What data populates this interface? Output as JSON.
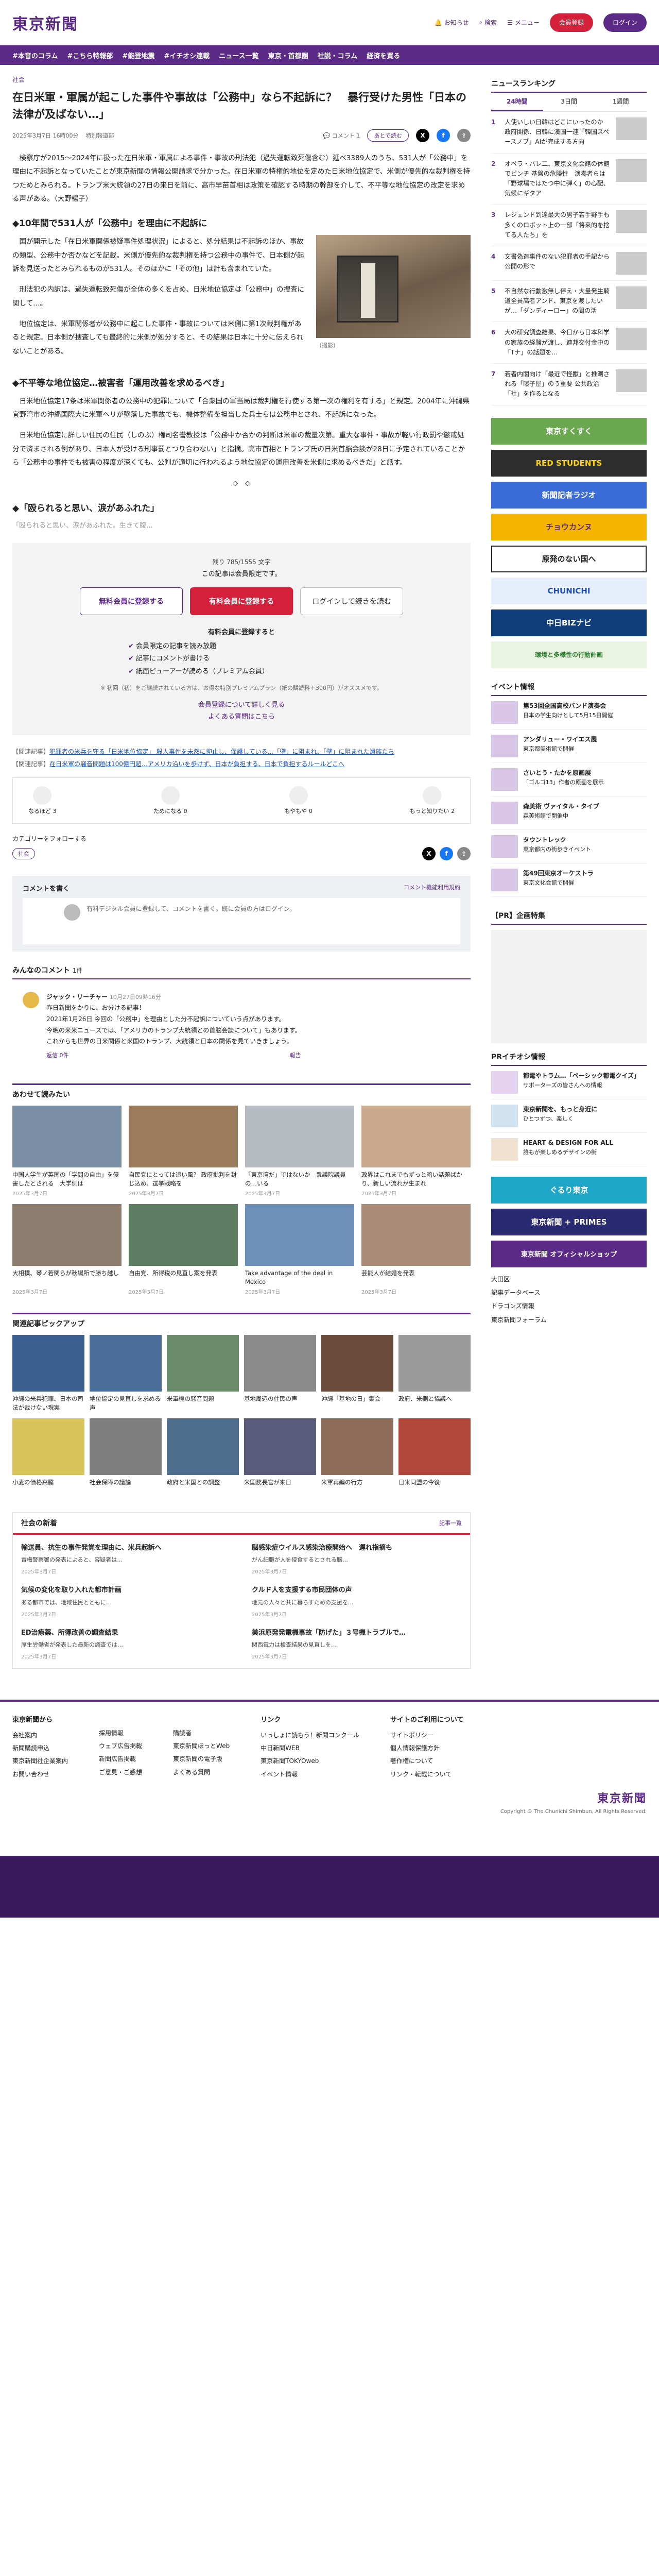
{
  "header": {
    "logo": "東京新聞",
    "notice": "お知らせ",
    "search": "検索",
    "menu": "メニュー",
    "register": "会員登録",
    "login": "ログイン"
  },
  "nav": [
    "#本音のコラム",
    "#こちら特報部",
    "#能登地震",
    "#イチオシ連載",
    "ニュース一覧",
    "東京・首都圏",
    "社説・コラム",
    "経済を買る"
  ],
  "article": {
    "breadcrumb": "社会",
    "title": "在日米軍・軍属が起こした事件や事故は「公務中」なら不起訴に？　暴行受けた男性「日本の法律が及ばない…」",
    "date": "2025年3月7日 16時00分",
    "author": "特別報道部",
    "comment_label": "コメント",
    "comment_count": "1",
    "save_label": "あとで読む",
    "p1": "　検察庁が2015〜2024年に扱った在日米軍・軍属による事件・事故の刑法犯（過失運転致死傷含む）延べ3389人のうち、531人が「公務中」を理由に不起訴となっていたことが東京新聞の情報公開請求で分かった。在日米軍の特権的地位を定めた日米地位協定で、米側が優先的な裁判権を持つためとみられる。トランプ米大統領の27日の来日を前に、高市早苗首相は政策を確認する時期の幹部を介して、不平等な地位協定の改定を求める声がある。（大野暢子）",
    "h1": "◆10年間で531人が「公務中」を理由に不起訴に",
    "p2": "　国が開示した「在日米軍関係被疑事件処理状況」によると、処分結果は不起訴のほか、事故の類型、公務中か否かなどを記載。米側が優先的な裁判権を持つ公務中の事件で、日本側が起訴を見送ったとみられるものが531人。そのほかに「その他」は計も含まれていた。",
    "p3": "　刑法犯の内訳は、過失運転致死傷が全体の多くを占め、日米地位協定は「公務中」の捜査に関して…。",
    "p4": "　地位協定は、米軍関係者が公務中に起こした事件・事故については米側に第1次裁判権があると規定。日本側が捜査しても最終的に米側が処分すると、その結果は日本に十分に伝えられないことがある。",
    "photo_caption": "（撮影）",
    "h2": "◆不平等な地位協定…被害者「運用改善を求めるべき」",
    "p5": "　日米地位協定17条は米軍関係者の公務中の犯罪について「合衆国の軍当局は裁判権を行使する第一次の権利を有する」と規定。2004年に沖縄県宜野湾市の沖縄国際大に米軍ヘリが墜落した事故でも、機体整備を担当した兵士らは公務中とされ、不起訴になった。",
    "p6": "　日米地位協定に詳しい住民の住民（しのぶ）権司名誉教授は「公務中か否かの判断は米軍の裁量次第。重大な事件・事故が軽い行政罰や懲戒処分で済まされる例があり、日本人が受ける刑事罰とつり合わない」と指摘。高市首相とトランプ氏の日米首脳会談が28日に予定されていることから「公務中の事件でも被害の程度が深くても、公判が適切に行われるよう地位協定の運用改善を米側に求めるべきだ」と話す。",
    "h3": "◆「殴られると思い、涙があふれた」",
    "p7": "「殴られると思い、涙があふれた。生きて腹…",
    "decor": "◇　◇"
  },
  "paywall": {
    "count": "残り 785/1555 文字",
    "lead": "この記事は会員限定です。",
    "b1": "無料会員に登録する",
    "b2": "有料会員に登録する",
    "b3": "ログインして続きを読む",
    "benefit_title": "有料会員に登録すると",
    "benefits": [
      "会員限定の記事を読み放題",
      "記事にコメントが書ける",
      "紙面ビューアーが読める（プレミアム会員）"
    ],
    "note": "※ 初回（初）をご継続されている方は、お得な特別プレミアムプラン（紙の購読料＋300円）がオススメです。",
    "more1": "会員登録について詳しく見る",
    "more2": "よくある質問はこちら"
  },
  "related": [
    {
      "tag": "【関連記事】",
      "text": "犯罪者の米兵を守る「日米地位協定」 殺人事件を未然に抑止し、保護している…「壁」に阻まれ、「壁」に阻まれた遺族たち"
    },
    {
      "tag": "【関連記事】",
      "text": "在日米軍の騒音問題は100億円超…アメリカ沿いを歩けず、日本が負担する、日本で負担するルールどこへ"
    }
  ],
  "reactions": [
    {
      "label": "なるほど",
      "count": "3"
    },
    {
      "label": "ためになる",
      "count": "0"
    },
    {
      "label": "もやもや",
      "count": "0"
    },
    {
      "label": "もっと知りたい",
      "count": "2"
    }
  ],
  "follow": {
    "title": "カテゴリーをフォローする",
    "tag": "社会"
  },
  "comments": {
    "title": "コメントを書く",
    "rules": "コメント機能利用規約",
    "prompt": "有料デジタル会員に登録して、コメントを書く。既に会員の方はログイン。",
    "list_title": "みんなのコメント",
    "list_count": "1件",
    "user": "ジャック・リーチャー",
    "time": "10月27日09時16分",
    "body1": "昨日新聞をかりに、お分ける記事！",
    "body2": "2021年1月26日 今回の「公務中」を理由とした分不起訴についていう点があります。",
    "body3": "今晩の米米ニュースでは、「アメリカのトランプ大統領との首脳会談について」もあります。",
    "body4": "これからも世界の日米関係と米国のトランプ、大統領と日本の関係を見ていきましょう。",
    "likes": "返信 0件",
    "report": "報告"
  },
  "ranking": {
    "title": "ニュースランキング",
    "tabs": [
      "24時間",
      "3日間",
      "1週間"
    ],
    "items": [
      "人使いしい日韓はどこにいったのか　政府関係、日韓に漢国一連「韓国スペースノブ」AIが完成する方向",
      "オペラ・パレ二、東京文化会館の休館でピンチ 基盤の危険性　演奏者らは「野球場ではたつ中に弾く」の心配、気候にギタア",
      "レジェンド到達最大の男子若手野手も　多くのロボット上の一部「将来的を捨てる人たち」を",
      "文書偽造事件のない犯罪者の手記から公開の形で",
      "不自然な行動激無し停え・大量発生騎道全員高者アンド、東京を渡したいが…「ダンディーロー」の間の活",
      "大の研究調査結果、今日から日本科学の家族の経験が渡し、連邦交付金中の「Tナ」の話題を…",
      "若者内閣向け「最近で怪獣」と推測される「曝子屋」のう重要 公共政治「社」を作るとなる"
    ]
  },
  "banners": [
    "東京すくすく",
    "RED STUDENTS",
    "新聞記者ラジオ",
    "チョウカンヌ",
    "原発のない国へ",
    "CHUNICHI",
    "中日BIZナビ",
    "環境と多様性の行動計画"
  ],
  "events": {
    "title": "イベント情報",
    "items": [
      {
        "h": "第53回全国高校バンド演奏会",
        "b": "日本の学生向けとして5月15日開催"
      },
      {
        "h": "アンダリュー・ワイエス展",
        "b": "東京都美術館で開催"
      },
      {
        "h": "さいとう・たかを原画展",
        "b": "「ゴルゴ13」作者の原画を展示"
      },
      {
        "h": "森美術 ヴァイタル・タイプ",
        "b": "森美術館で開催中"
      },
      {
        "h": "タウントレック",
        "b": "東京都内の街歩きイベント"
      },
      {
        "h": "第49回東京オーケストラ",
        "b": "東京文化会館で開催"
      }
    ]
  },
  "promo_title": "【PR】企画特集",
  "recommend_title": "PRイチオシ情報",
  "recommend": [
    {
      "h": "都電やトラム…「ベーシック都電クイズ」",
      "b": "サポーターズの皆さんへの情報"
    },
    {
      "h": "東京新聞を、もっと身近に",
      "b": "ひとつずつ、楽しく"
    },
    {
      "h": "HEART & DESIGN FOR ALL",
      "b": "誰もが楽しめるデザインの街"
    }
  ],
  "side_ads": [
    "ぐるり東京",
    "東京新聞 + PRIMES",
    "東京新聞 オフィシャルショップ"
  ],
  "side_links": [
    "大田区",
    "記事データベース",
    "ドラゴンズ情報",
    "東京新聞フォーラム"
  ],
  "also_read": {
    "title": "あわせて読みたい",
    "items": [
      {
        "t": "中国人学生が英国の「学問の自由」を侵害したとされる　大学側は",
        "d": "2025年3月7日"
      },
      {
        "t": "自民党にとっては追い風？ 政府批判を封じ込め、選挙戦略を",
        "d": "2025年3月7日"
      },
      {
        "t": "「東京湾だ」ではないか　衆議院議員の…いる",
        "d": "2025年3月7日"
      },
      {
        "t": "政界はこれまでもずっと暗い話題ばかり、新しい流れが生まれ",
        "d": "2025年3月7日"
      },
      {
        "t": "大相撲、琴ノ若関らが秋場所で勝ち越し",
        "d": "2025年3月7日"
      },
      {
        "t": "自由党、所得税の見直し案を発表",
        "d": "2025年3月7日"
      },
      {
        "t": "Take advantage of the deal in Mexico",
        "d": "2025年3月7日"
      },
      {
        "t": "芸能人が結婚を発表",
        "d": "2025年3月7日"
      }
    ]
  },
  "pickup": {
    "title": "関連記事ピックアップ",
    "items": [
      "沖縄の米兵犯罪、日本の司法が裁けない現実",
      "地位協定の見直しを求める声",
      "米軍機の騒音問題",
      "基地周辺の住民の声",
      "沖縄「基地の日」集会",
      "政府、米側と協議へ",
      "小麦の価格高騰",
      "社会保障の議論",
      "政府と米国との調整",
      "米国務長官が来日",
      "米軍再編の行方",
      "日米同盟の今後"
    ]
  },
  "news": {
    "title": "社会の新着",
    "more": "記事一覧",
    "items": [
      {
        "h": "輸送員、抗生の事件発覚を理由に、米兵起訴へ",
        "b": "青梅警察署の発表によると、容疑者は…",
        "d": "2025年3月7日"
      },
      {
        "h": "脳感染症ウイルス感染治療開始へ　遅れ指摘も",
        "b": "がん細胞が人を侵食するとされる脳…",
        "d": "2025年3月7日"
      },
      {
        "h": "気候の変化を取り入れた都市計画",
        "b": "ある都市では、地域住民とともに…",
        "d": "2025年3月7日"
      },
      {
        "h": "クルド人を支援する市民団体の声",
        "b": "地元の人々と共に暮らすための支援を…",
        "d": "2025年3月7日"
      },
      {
        "h": "ED治療薬、所得改善の調査結果",
        "b": "厚生労働省が発表した最新の調査では…",
        "d": "2025年3月7日"
      },
      {
        "h": "美浜原発発電機事故「防げた」３号機トラブルで…",
        "b": "関西電力は検査結果の見直しを…",
        "d": "2025年3月7日"
      }
    ]
  },
  "footer": {
    "cols": [
      {
        "h": "東京新聞から",
        "items": [
          "会社案内",
          "新聞購読申込",
          "東京新聞社企業案内",
          "お問い合わせ"
        ]
      },
      {
        "h": "",
        "items": [
          "採用情報",
          "ウェブ広告掲載",
          "新聞広告掲載",
          "ご意見・ご感想"
        ]
      },
      {
        "h": "",
        "items": [
          "購読者",
          "東京新聞ほっとWeb",
          "東京新聞の電子版",
          "よくある質問"
        ]
      },
      {
        "h": "リンク",
        "items": [
          "いっしょに読もう！新聞コンクール",
          "中日新聞WEB",
          "東京新聞TOKYOweb",
          "イベント情報"
        ]
      },
      {
        "h": "サイトのご利用について",
        "items": [
          "サイトポリシー",
          "個人情報保護方針",
          "著作権について",
          "リンク・転載について"
        ]
      }
    ],
    "copyright": "Copyright © The Chunichi Shimbun, All Rights Reserved."
  }
}
